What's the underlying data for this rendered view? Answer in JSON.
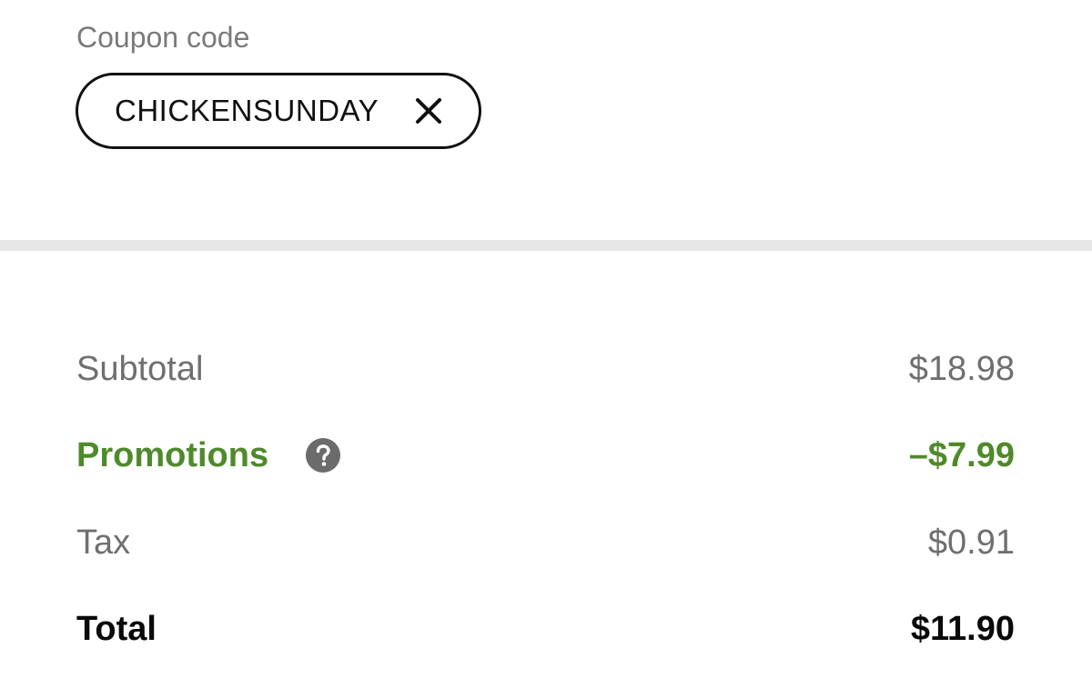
{
  "coupon": {
    "label": "Coupon code",
    "code": "CHICKENSUNDAY",
    "remove_icon": "close-icon"
  },
  "summary": {
    "subtotal": {
      "label": "Subtotal",
      "value": "$18.98"
    },
    "promotions": {
      "label": "Promotions",
      "value": "–$7.99",
      "help_icon": "question-circle-icon"
    },
    "tax": {
      "label": "Tax",
      "value": "$0.91"
    },
    "total": {
      "label": "Total",
      "value": "$11.90"
    }
  },
  "colors": {
    "promo_green": "#4e8a2a",
    "muted_text": "#6f6f6f",
    "divider": "#e6e6e6"
  }
}
